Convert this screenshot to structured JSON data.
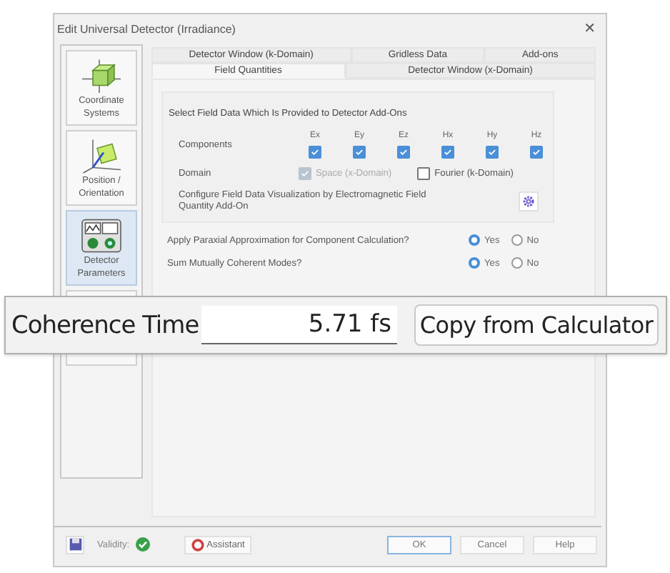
{
  "window": {
    "title": "Edit Universal Detector (Irradiance)",
    "close": "✕"
  },
  "sidebar": {
    "items": [
      {
        "label": "Coordinate Systems",
        "kind": "coords",
        "selected": false
      },
      {
        "label": "Position / Orientation",
        "kind": "position",
        "selected": false
      },
      {
        "label": "Detector Parameters",
        "kind": "detector",
        "selected": true
      },
      {
        "selected": false
      }
    ]
  },
  "tabs": {
    "back_row": [
      {
        "label": "Detector Window (k-Domain)",
        "selected": false
      },
      {
        "label": "Gridless Data",
        "selected": false
      },
      {
        "label": "Add-ons",
        "selected": false
      }
    ],
    "front_row": [
      {
        "label": "Field Quantities",
        "selected": true
      },
      {
        "label": "Detector Window (x-Domain)",
        "selected": false
      }
    ]
  },
  "group": {
    "title": "Select Field Data Which Is Provided to Detector Add-Ons",
    "components_label": "Components",
    "components": [
      {
        "label": "Ex",
        "checked": true
      },
      {
        "label": "Ey",
        "checked": true
      },
      {
        "label": "Ez",
        "checked": true
      },
      {
        "label": "Hx",
        "checked": true
      },
      {
        "label": "Hy",
        "checked": true
      },
      {
        "label": "Hz",
        "checked": true
      }
    ],
    "domain_label": "Domain",
    "domains": [
      {
        "label": "Space (x-Domain)",
        "checked": true,
        "disabled": true
      },
      {
        "label": "Fourier (k-Domain)",
        "checked": false,
        "disabled": false
      }
    ],
    "configure": "Configure Field Data Visualization by Electromagnetic Field Quantity Add-On"
  },
  "questions": [
    {
      "label": "Apply Paraxial Approximation for Component Calculation?",
      "options": [
        {
          "label": "Yes",
          "selected": true
        },
        {
          "label": "No",
          "selected": false
        }
      ]
    },
    {
      "label": "Sum Mutually Coherent Modes?",
      "options": [
        {
          "label": "Yes",
          "selected": true
        },
        {
          "label": "No",
          "selected": false
        }
      ]
    }
  ],
  "callout": {
    "label": "Coherence Time",
    "value": "5.71 fs",
    "button": "Copy from Calculator"
  },
  "footer": {
    "validity": "Validity:",
    "valid": true,
    "assistant": "Assistant",
    "buttons": [
      "OK",
      "Cancel",
      "Help"
    ]
  }
}
